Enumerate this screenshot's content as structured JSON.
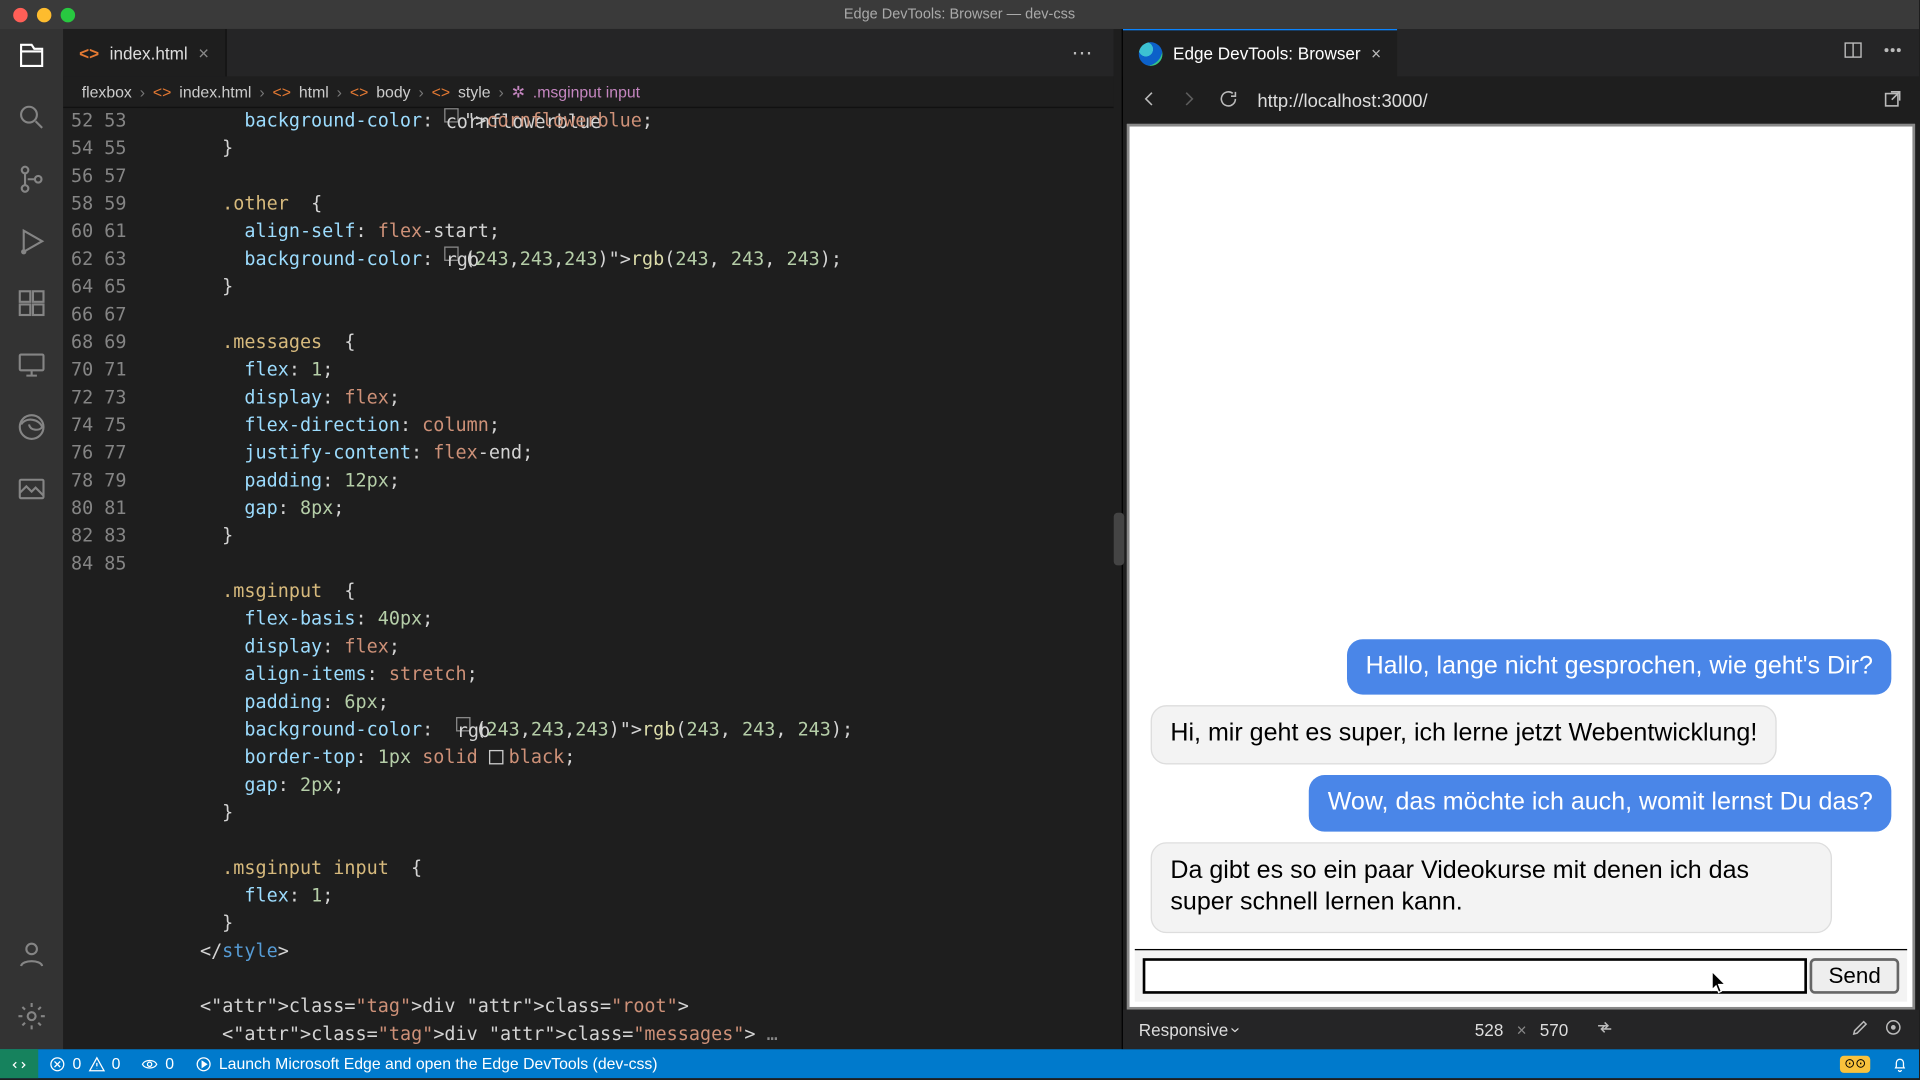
{
  "window_title": "Edge DevTools: Browser — dev-css",
  "editor": {
    "tab": {
      "file_icon": "<>",
      "label": "index.html"
    },
    "breadcrumbs": [
      "flexbox",
      "index.html",
      "html",
      "body",
      "style",
      ".msginput input"
    ],
    "line_start": 52,
    "lines": [
      "        background-color: SW_CFBcornflowerblue;",
      "      }",
      "",
      "      .other {",
      "        align-self: flex-start;",
      "        background-color: SW_RGBrgb(243, 243, 243);",
      "      }",
      "",
      "      .messages {",
      "        flex: 1;",
      "        display: flex;",
      "        flex-direction: column;",
      "        justify-content: flex-end;",
      "        padding: 12px;",
      "        gap: 8px;",
      "      }",
      "",
      "      .msginput {",
      "        flex-basis: 40px;",
      "        display: flex;",
      "        align-items: stretch;",
      "        padding: 6px;",
      "        background-color:  SW_RGBrgb(243, 243, 243);",
      "        border-top: 1px solid SW_BLKblack;",
      "        gap: 2px;",
      "      }",
      "",
      "      .msginput input {",
      "        flex: 1;",
      "      }",
      "    </style>",
      "",
      "    <div class=\"root\">",
      "      <div class=\"messages\"> …"
    ]
  },
  "devtools": {
    "tab_label": "Edge DevTools: Browser",
    "url": "http://localhost:3000/",
    "chat": {
      "messages": [
        {
          "side": "me",
          "text": "Hallo, lange nicht gesprochen, wie geht's Dir?"
        },
        {
          "side": "other",
          "text": "Hi, mir geht es super, ich lerne jetzt Webentwicklung!"
        },
        {
          "side": "me",
          "text": "Wow, das möchte ich auch, womit lernst Du das?"
        },
        {
          "side": "other",
          "text": "Da gibt es so ein paar Videokurse mit denen ich das super schnell lernen kann."
        }
      ],
      "send_label": "Send"
    },
    "footer": {
      "mode": "Responsive",
      "w": "528",
      "h": "570"
    }
  },
  "statusbar": {
    "errors": "0",
    "warnings": "0",
    "ports": "0",
    "launch": "Launch Microsoft Edge and open the Edge DevTools (dev-css)"
  }
}
